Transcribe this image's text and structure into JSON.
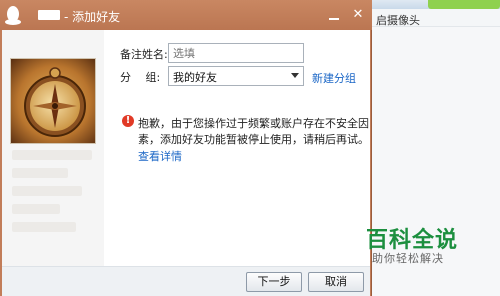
{
  "background_app": {
    "camera_label": "启摄像头"
  },
  "dialog": {
    "title": "- 添加好友",
    "remark_label": "备注姓名:",
    "remark_placeholder": "选填",
    "group_label": "分　 组:",
    "group_value": "我的好友",
    "new_group_link": "新建分组",
    "warning_line1": "抱歉，由于您操作过于频繁或账户存在不安全因",
    "warning_line2": "素，添加好友功能暂被停止使用，请稍后再试。",
    "details_link": "查看详情",
    "next_button": "下一步",
    "cancel_button": "取消",
    "window_controls": {
      "minimize": "minimize-icon",
      "close": "close-icon"
    }
  },
  "watermark": {
    "title": "百科全说",
    "subtitle": "助你轻松解决"
  },
  "colors": {
    "titlebar": "#c27d59",
    "link": "#1a66c6",
    "warning": "#e13a26",
    "watermark_green": "#1c8f3f"
  }
}
